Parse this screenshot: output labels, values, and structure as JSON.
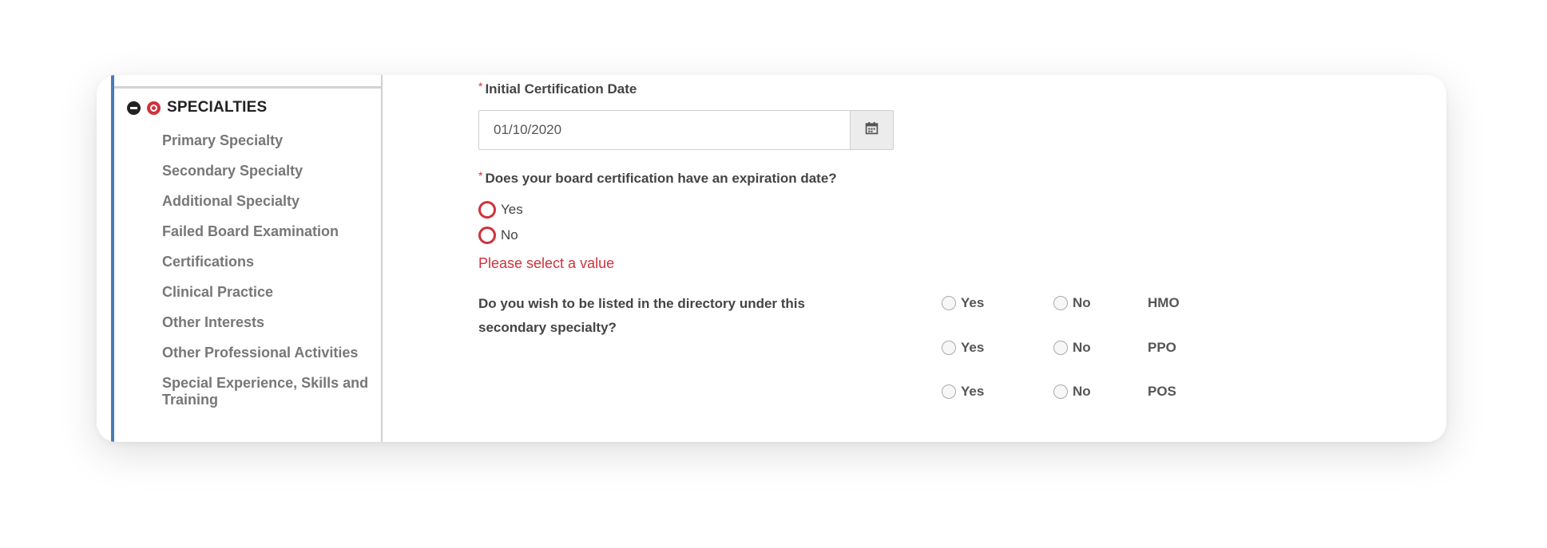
{
  "sidebar": {
    "section_title": "SPECIALTIES",
    "items": [
      {
        "label": "Primary Specialty"
      },
      {
        "label": "Secondary Specialty"
      },
      {
        "label": "Additional Specialty"
      },
      {
        "label": "Failed Board Examination"
      },
      {
        "label": "Certifications"
      },
      {
        "label": "Clinical Practice"
      },
      {
        "label": "Other Interests"
      },
      {
        "label": "Other Professional Activities"
      },
      {
        "label": "Special Experience, Skills and Training"
      }
    ]
  },
  "form": {
    "required_mark": "*",
    "initial_cert": {
      "label": "Initial Certification Date",
      "value": "01/10/2020"
    },
    "expiration": {
      "label": "Does your board certification have an expiration date?",
      "options": [
        "Yes",
        "No"
      ],
      "error": "Please select a value"
    },
    "directory": {
      "label": "Do you wish to be listed in the directory under this secondary specialty?",
      "rows": [
        {
          "yes": "Yes",
          "no": "No",
          "plan": "HMO"
        },
        {
          "yes": "Yes",
          "no": "No",
          "plan": "PPO"
        },
        {
          "yes": "Yes",
          "no": "No",
          "plan": "POS"
        }
      ]
    }
  },
  "colors": {
    "error": "#d0313a",
    "sidebar_accent": "#4a7bb8"
  },
  "icons": [
    "collapse-icon",
    "error-icon",
    "calendar-icon"
  ]
}
